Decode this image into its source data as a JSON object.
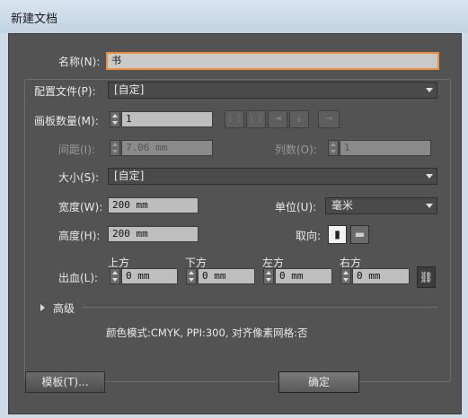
{
  "window": {
    "title": "新建文档"
  },
  "name": {
    "label": "名称(N):",
    "value": "书"
  },
  "profile": {
    "label": "配置文件(P):",
    "value": "[自定]"
  },
  "artboards": {
    "label": "画板数量(M):",
    "value": "1",
    "layout_icons": [
      "grid-by-row-icon",
      "grid-by-column-icon",
      "arrange-by-row-icon",
      "arrange-by-column-icon",
      "right-to-left-icon"
    ]
  },
  "spacing": {
    "label": "间距(I):",
    "value": "7.06 mm"
  },
  "columns": {
    "label": "列数(O):",
    "value": "1"
  },
  "size": {
    "label": "大小(S):",
    "value": "[自定]"
  },
  "width": {
    "label": "宽度(W):",
    "value": "200 mm"
  },
  "units": {
    "label": "单位(U):",
    "value": "毫米"
  },
  "height": {
    "label": "高度(H):",
    "value": "200 mm"
  },
  "orientation": {
    "label": "取向:",
    "selected": "portrait"
  },
  "bleed": {
    "label": "出血(L):",
    "top_label": "上方",
    "top": "0 mm",
    "bottom_label": "下方",
    "bottom": "0 mm",
    "left_label": "左方",
    "left": "0 mm",
    "right_label": "右方",
    "right": "0 mm"
  },
  "advanced": {
    "label": "高级"
  },
  "summary": "颜色模式:CMYK, PPI:300, 对齐像素网格:否",
  "buttons": {
    "templates": "模板(T)...",
    "ok": "确定"
  },
  "colors": {
    "dialog_bg": "#535353",
    "focus_border": "#e8903a",
    "titlebar": "#cfdbe6"
  }
}
